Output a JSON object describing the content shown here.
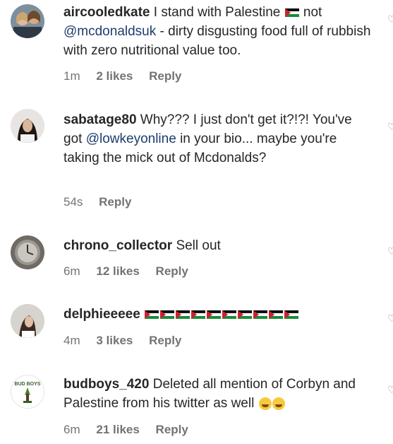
{
  "comments": [
    {
      "username": "aircooledkate",
      "text_before": "I stand with Palestine",
      "text_mid": "not",
      "mention": "@mcdonaldsuk",
      "text_after": "- dirty disgusting food full of rubbish with zero nutritional value too.",
      "time": "1m",
      "likes": "2 likes",
      "reply": "Reply"
    },
    {
      "username": "sabatage80",
      "text_before": "Why??? I just don't get it?!?! You've got",
      "mention": "@lowkeyonline",
      "text_after": "in your bio... maybe you're taking the mick out of Mcdonalds?",
      "time": "54s",
      "reply": "Reply"
    },
    {
      "username": "chrono_collector",
      "text": "Sell out",
      "time": "6m",
      "likes": "12 likes",
      "reply": "Reply"
    },
    {
      "username": "delphieeeee",
      "flag_count": 10,
      "time": "4m",
      "likes": "3 likes",
      "reply": "Reply"
    },
    {
      "username": "budboys_420",
      "avatar_text": "BUD BOYS",
      "text": "Deleted all mention of Corbyn and Palestine from his twitter as well",
      "time": "6m",
      "likes": "21 likes",
      "reply": "Reply"
    }
  ],
  "colors": {
    "mention": "#1d3c6e",
    "meta": "#737373",
    "text": "#262626"
  },
  "icons": {
    "heart": "heart-icon",
    "flag": "palestine-flag-icon"
  }
}
